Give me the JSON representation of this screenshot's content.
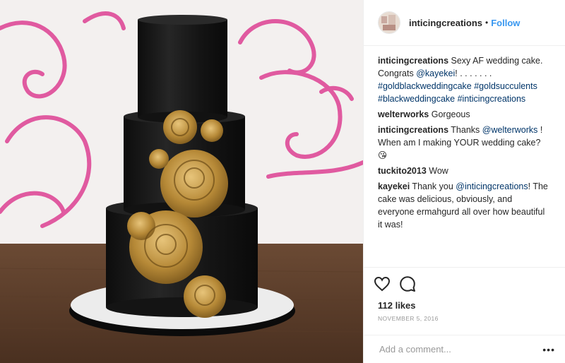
{
  "header": {
    "username": "inticingcreations",
    "separator": "•",
    "follow_label": "Follow"
  },
  "caption": {
    "username": "inticingcreations",
    "text": " Sexy AF wedding cake. Congrats ",
    "mention": "@kayekei",
    "after_mention": "! . . . . . . . ",
    "hashtags": [
      "#goldblackweddingcake",
      "#goldsucculents",
      "#blackweddingcake",
      "#inticingcreations"
    ]
  },
  "comments": [
    {
      "username": "welterworks",
      "text": " Gorgeous"
    },
    {
      "username": "inticingcreations",
      "text_before": " Thanks ",
      "mention": "@welterworks",
      "text_after": " ! When am I making YOUR wedding cake? 😘"
    },
    {
      "username": "tuckito2013",
      "text": " Wow"
    },
    {
      "username": "kayekei",
      "text_before": " Thank you ",
      "mention": "@inticingcreations",
      "text_after": "! The cake was delicious, obviously, and everyone ermahgurd all over how beautiful it was!"
    }
  ],
  "actions": {
    "like_icon": "heart-icon",
    "comment_icon": "comment-bubble-icon",
    "likes": "112 likes",
    "date": "NOVEMBER 5, 2016"
  },
  "add_comment": {
    "placeholder": "Add a comment...",
    "more_label": "•••"
  },
  "colors": {
    "link": "#003569",
    "follow": "#3897f0",
    "cake": "#161616",
    "gold": "#a37a2e",
    "swirl": "#e05aa0"
  }
}
